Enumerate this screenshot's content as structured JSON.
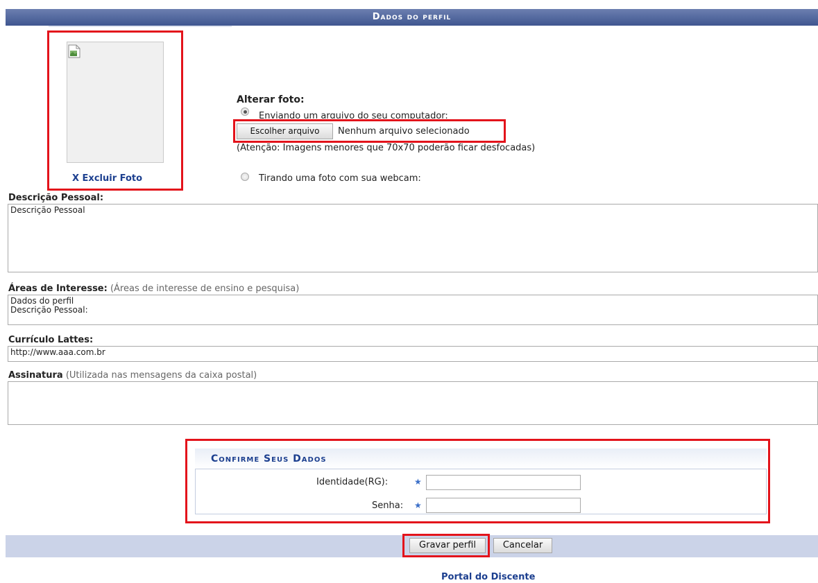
{
  "header": {
    "title": "Dados do perfil"
  },
  "photo": {
    "broken_image_icon": "broken-image-icon",
    "delete_label": "X Excluir Foto"
  },
  "change_photo": {
    "title": "Alterar foto:",
    "option_upload": "Enviando um arquivo do seu computador:",
    "choose_button": "Escolher arquivo",
    "no_file": "Nenhum arquivo selecionado",
    "hint": "(Atenção: Imagens menores que 70x70 poderão ficar desfocadas)",
    "option_webcam": "Tirando uma foto com sua webcam:"
  },
  "fields": {
    "personal_description": {
      "label": "Descrição Pessoal:",
      "value": "Descrição Pessoal"
    },
    "interests": {
      "label": "Áreas de Interesse:",
      "hint": "(Áreas de interesse de ensino e pesquisa)",
      "line1": "Dados do perfil",
      "line2": "Descrição Pessoal:"
    },
    "lattes": {
      "label": "Currículo Lattes:",
      "value": "http://www.aaa.com.br"
    },
    "signature": {
      "label": "Assinatura",
      "hint": "(Utilizada nas mensagens da caixa postal)",
      "value": ""
    }
  },
  "confirm": {
    "title": "Confirme Seus Dados",
    "rg_label": "Identidade(RG):",
    "password_label": "Senha:",
    "required_icon": "star-icon",
    "required_mark": "★"
  },
  "actions": {
    "save": "Gravar perfil",
    "cancel": "Cancelar"
  },
  "footer": {
    "link": "Portal do Discente"
  },
  "colors": {
    "header_bg": "#3f5690",
    "highlight": "#e3131b",
    "link": "#1c3f8f",
    "footer_bar": "#cbd3e8"
  }
}
